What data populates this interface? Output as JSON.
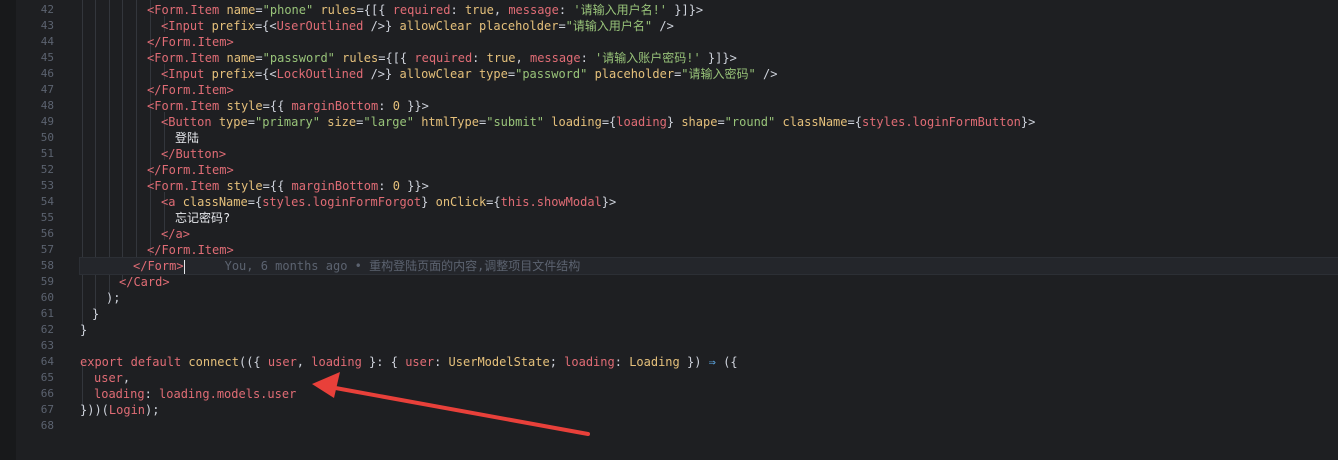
{
  "gutter": {
    "line_numbers": [
      "42",
      "43",
      "44",
      "45",
      "46",
      "47",
      "48",
      "49",
      "50",
      "51",
      "52",
      "53",
      "54",
      "55",
      "56",
      "57",
      "58",
      "59",
      "60",
      "61",
      "62",
      "63",
      "64",
      "65",
      "66",
      "67",
      "68"
    ]
  },
  "code": {
    "l42": {
      "open": "<",
      "tag": "Form.Item",
      "a1": "name",
      "v1": "\"phone\"",
      "a2": "rules",
      "p1": "={[{ ",
      "k1": "required",
      "c1": ": ",
      "b1": "true",
      "c2": ", ",
      "k2": "message",
      "c3": ": ",
      "s1": "'请输入用户名!'",
      "close": " }]}>"
    },
    "l43": {
      "open": "<",
      "tag": "Input",
      "a1": "prefix",
      "p1": "={<",
      "tag2": "UserOutlined",
      "p2": " />} ",
      "a2": "allowClear",
      "a3": "placeholder",
      "v1": "\"请输入用户名\"",
      "close": " />"
    },
    "l44": {
      "open": "</",
      "tag": "Form.Item",
      "close": ">"
    },
    "l45": {
      "open": "<",
      "tag": "Form.Item",
      "a1": "name",
      "v1": "\"password\"",
      "a2": "rules",
      "p1": "={[{ ",
      "k1": "required",
      "c1": ": ",
      "b1": "true",
      "c2": ", ",
      "k2": "message",
      "c3": ": ",
      "s1": "'请输入账户密码!'",
      "close": " }]}>"
    },
    "l46": {
      "open": "<",
      "tag": "Input",
      "a1": "prefix",
      "p1": "={<",
      "tag2": "LockOutlined",
      "p2": " />} ",
      "a2": "allowClear",
      "a3": "type",
      "v1": "\"password\"",
      "a4": "placeholder",
      "v2": "\"请输入密码\"",
      "close": " />"
    },
    "l47": {
      "open": "</",
      "tag": "Form.Item",
      "close": ">"
    },
    "l48": {
      "open": "<",
      "tag": "Form.Item",
      "a1": "style",
      "p1": "={{ ",
      "k1": "marginBottom",
      "c1": ": ",
      "n1": "0",
      "close": " }}>"
    },
    "l49": {
      "open": "<",
      "tag": "Button",
      "a1": "type",
      "v1": "\"primary\"",
      "a2": "size",
      "v2": "\"large\"",
      "a3": "htmlType",
      "v3": "\"submit\"",
      "a4": "loading",
      "p1": "={",
      "k1": "loading",
      "p2": "} ",
      "a5": "shape",
      "v4": "\"round\"",
      "a6": "className",
      "p3": "={",
      "k2": "styles.loginFormButton",
      "close": "}>"
    },
    "l50": {
      "text": "登陆"
    },
    "l51": {
      "open": "</",
      "tag": "Button",
      "close": ">"
    },
    "l52": {
      "open": "</",
      "tag": "Form.Item",
      "close": ">"
    },
    "l53": {
      "open": "<",
      "tag": "Form.Item",
      "a1": "style",
      "p1": "={{ ",
      "k1": "marginBottom",
      "c1": ": ",
      "n1": "0",
      "close": " }}>"
    },
    "l54": {
      "open": "<",
      "tag": "a",
      "a1": "className",
      "p1": "={",
      "k1": "styles.loginFormForgot",
      "p2": "} ",
      "a2": "onClick",
      "p3": "={",
      "k2": "this.showModal",
      "close": "}>"
    },
    "l55": {
      "text": "忘记密码?"
    },
    "l56": {
      "open": "</",
      "tag": "a",
      "close": ">"
    },
    "l57": {
      "open": "</",
      "tag": "Form.Item",
      "close": ">"
    },
    "l58": {
      "open": "</",
      "tag": "Form",
      "close": ">",
      "blame": "You, 6 months ago • 重构登陆页面的内容,调整项目文件结构"
    },
    "l59": {
      "open": "</",
      "tag": "Card",
      "close": ">"
    },
    "l60": {
      "text": ");"
    },
    "l61": {
      "text": "}"
    },
    "l62": {
      "text": "}"
    },
    "l64": {
      "k1": "export",
      "k2": "default",
      "fn": "connect",
      "p1": "(({ ",
      "k3": "user",
      "c1": ", ",
      "k4": "loading",
      "p2": " }: { ",
      "k5": "user",
      "c2": ": ",
      "t1": "UserModelState",
      "c3": "; ",
      "k6": "loading",
      "c4": ": ",
      "t2": "Loading",
      "p3": " }) ",
      "arrow": "⇒",
      "p4": " ({"
    },
    "l65": {
      "k1": "user",
      "c1": ","
    },
    "l66": {
      "k1": "loading",
      "c1": ": ",
      "k2": "loading.models.user"
    },
    "l67": {
      "p1": "}))(",
      "k1": "Login",
      "p2": ");"
    }
  },
  "annotation": {
    "arrow_color": "#e8403a"
  }
}
